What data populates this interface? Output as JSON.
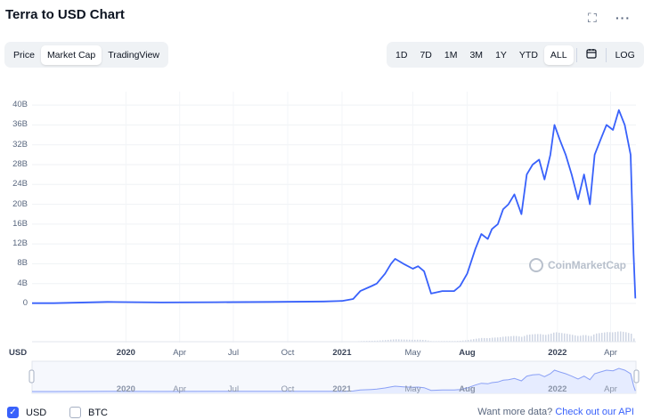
{
  "title": "Terra to USD Chart",
  "header": {
    "expand_icon": "expand-icon",
    "more_icon": "more-horizontal-icon"
  },
  "view_tabs": [
    "Price",
    "Market Cap",
    "TradingView"
  ],
  "active_view": "Market Cap",
  "range_tabs": [
    "1D",
    "7D",
    "1M",
    "3M",
    "1Y",
    "YTD",
    "ALL"
  ],
  "active_range": "ALL",
  "calendar_icon": "calendar-icon",
  "log_label": "LOG",
  "currency_label": "USD",
  "watermark": "CoinMarketCap",
  "legend": [
    {
      "label": "USD",
      "checked": true
    },
    {
      "label": "BTC",
      "checked": false
    }
  ],
  "cta": {
    "text": "Want more data?",
    "link": "Check out our API"
  },
  "colors": {
    "line": "#3861fb",
    "accent": "#3861fb",
    "volume": "#cfd6e4",
    "navigator_fill": "#e6ecff"
  },
  "chart_data": {
    "type": "line",
    "series_unit": "USD",
    "y_ticks": [
      "40B",
      "36B",
      "32B",
      "28B",
      "24B",
      "20B",
      "16B",
      "12B",
      "8B",
      "4B",
      "0"
    ],
    "ylim": [
      0,
      42
    ],
    "x_ticks": [
      "2020",
      "Apr",
      "Jul",
      "Oct",
      "2021",
      "May",
      "Aug",
      "2022",
      "Apr"
    ],
    "bold_x_ticks": [
      "2020",
      "2021",
      "Aug",
      "2022"
    ],
    "navigator_ticks": [
      "2020",
      "Apr",
      "Jul",
      "Oct",
      "2021",
      "May",
      "Aug",
      "2022",
      "Apr"
    ],
    "x": [
      "2019-07-26",
      "2019-09",
      "2019-12",
      "2020-03",
      "2020-06",
      "2020-09",
      "2020-12",
      "2021-01",
      "2021-01-20",
      "2021-02",
      "2021-02-20",
      "2021-03",
      "2021-03-15",
      "2021-03-25",
      "2021-04",
      "2021-04-15",
      "2021-05-01",
      "2021-05-10",
      "2021-05-20",
      "2021-06",
      "2021-06-20",
      "2021-07-10",
      "2021-07-20",
      "2021-08-01",
      "2021-08-15",
      "2021-08-25",
      "2021-09-05",
      "2021-09-12",
      "2021-09-22",
      "2021-10-01",
      "2021-10-10",
      "2021-10-20",
      "2021-11-01",
      "2021-11-10",
      "2021-11-20",
      "2021-12-01",
      "2021-12-10",
      "2021-12-20",
      "2021-12-27",
      "2022-01-05",
      "2022-01-15",
      "2022-01-25",
      "2022-02-05",
      "2022-02-15",
      "2022-02-25",
      "2022-03-05",
      "2022-03-15",
      "2022-03-25",
      "2022-04-05",
      "2022-04-15",
      "2022-04-25",
      "2022-05-05",
      "2022-05-10",
      "2022-05-13"
    ],
    "values": [
      0.05,
      0.05,
      0.3,
      0.2,
      0.25,
      0.3,
      0.4,
      0.5,
      0.9,
      2.5,
      3.5,
      4,
      6,
      8,
      9,
      8,
      7,
      7.5,
      6.5,
      2,
      2.5,
      2.5,
      3.5,
      6,
      11,
      14,
      13,
      15,
      16,
      19,
      20,
      22,
      18,
      26,
      28,
      29,
      25,
      30,
      36,
      33,
      30,
      26,
      21,
      26,
      20,
      30,
      33,
      36,
      35,
      39,
      36,
      30,
      10,
      1
    ]
  }
}
